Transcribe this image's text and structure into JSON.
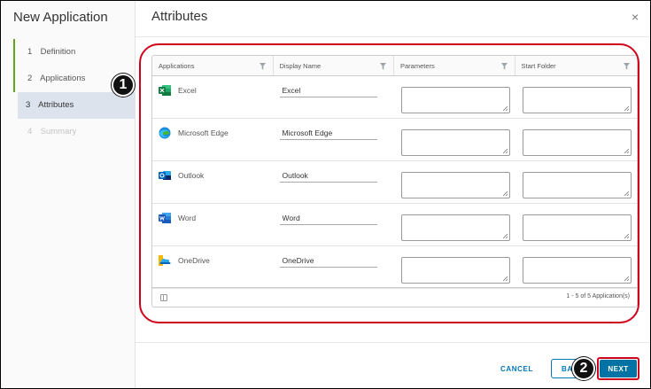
{
  "wizard": {
    "title": "New Application",
    "steps": [
      {
        "num": "1",
        "label": "Definition"
      },
      {
        "num": "2",
        "label": "Applications"
      },
      {
        "num": "3",
        "label": "Attributes"
      },
      {
        "num": "4",
        "label": "Summary"
      }
    ]
  },
  "main": {
    "title": "Attributes",
    "close_icon": "×"
  },
  "grid": {
    "columns": [
      "Applications",
      "Display Name",
      "Parameters",
      "Start Folder"
    ],
    "rows": [
      {
        "app": "Excel",
        "icon": "excel-icon",
        "display_name": "Excel"
      },
      {
        "app": "Microsoft Edge",
        "icon": "edge-icon",
        "display_name": "Microsoft Edge"
      },
      {
        "app": "Outlook",
        "icon": "outlook-icon",
        "display_name": "Outlook"
      },
      {
        "app": "Word",
        "icon": "word-icon",
        "display_name": "Word"
      },
      {
        "app": "OneDrive",
        "icon": "onedrive-icon",
        "display_name": "OneDrive"
      }
    ],
    "footer_count": "1 - 5 of 5 Application(s)"
  },
  "annotations": {
    "badge1": "1",
    "badge2": "2"
  },
  "footer": {
    "cancel_label": "CANCEL",
    "back_label": "BACK",
    "next_label": "NEXT"
  },
  "colors": {
    "accent": "#0072a3",
    "step_done": "#62a420",
    "annotation": "#d0021b"
  }
}
